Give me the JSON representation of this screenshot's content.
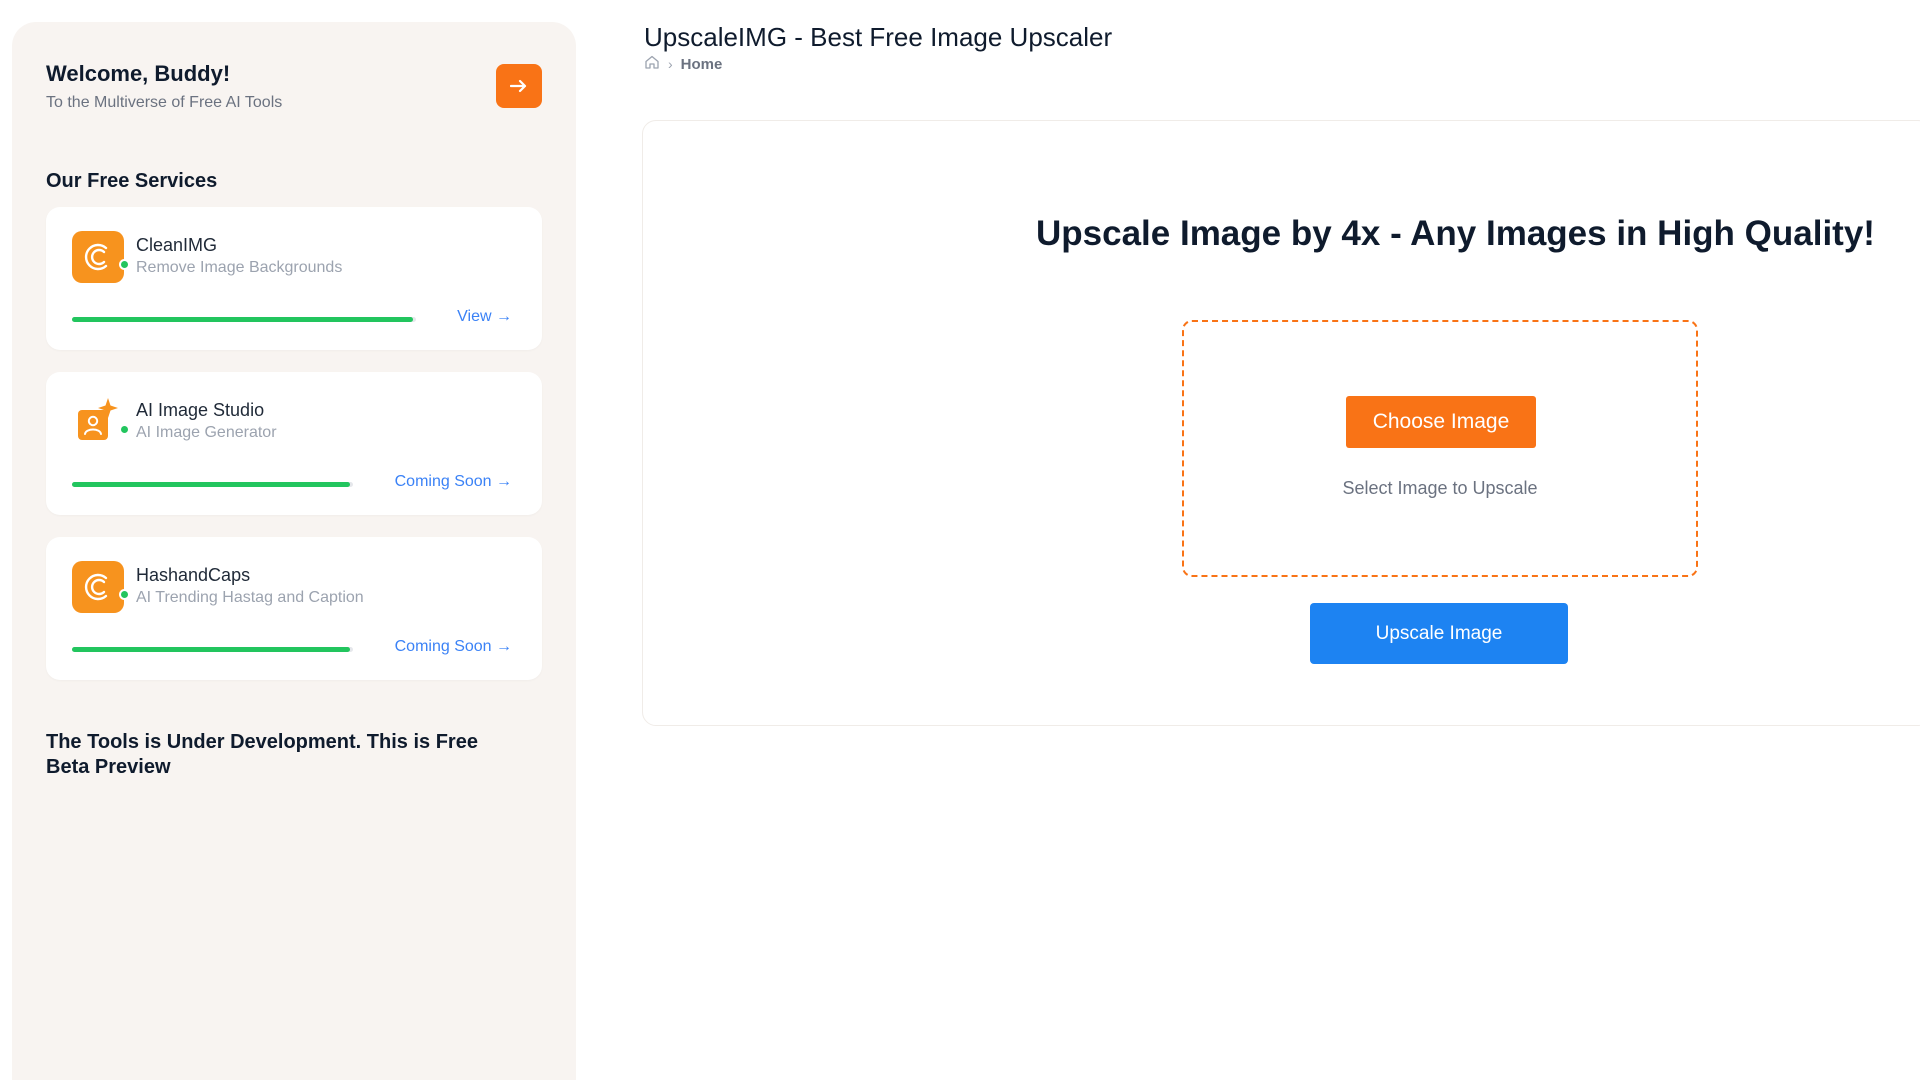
{
  "sidebar": {
    "welcome_title": "Welcome, Buddy!",
    "welcome_subtitle": "To the Multiverse of Free AI Tools",
    "arrow_icon": "arrow-right-icon",
    "section_title": "Our Free Services",
    "services": [
      {
        "name": "CleanIMG",
        "description": "Remove Image Backgrounds",
        "link": "View →",
        "icon": "cleanimg-logo-icon",
        "progress": 0.99
      },
      {
        "name": "AI Image Studio",
        "description": "AI Image Generator",
        "link": "Coming Soon →",
        "icon": "ai-image-studio-icon",
        "progress": 0.99
      },
      {
        "name": "HashandCaps",
        "description": "AI Trending Hastag and Caption",
        "link": "Coming Soon →",
        "icon": "hashandcaps-logo-icon",
        "progress": 0.99
      }
    ],
    "dev_note": "The Tools is Under Development. This is Free Beta Preview"
  },
  "header": {
    "title": "UpscaleIMG - Best Free Image Upscaler",
    "breadcrumb": {
      "home_icon": "home-icon",
      "current": "Home"
    }
  },
  "main": {
    "headline": "Upscale Image by 4x - Any Images in High Quality!",
    "choose_button": "Choose Image",
    "select_hint": "Select Image to Upscale",
    "upscale_button": "Upscale Image"
  },
  "colors": {
    "accent_orange": "#f97316",
    "accent_blue": "#1d83f2",
    "status_green": "#22c55e",
    "sidebar_bg": "#f8f4f1"
  }
}
